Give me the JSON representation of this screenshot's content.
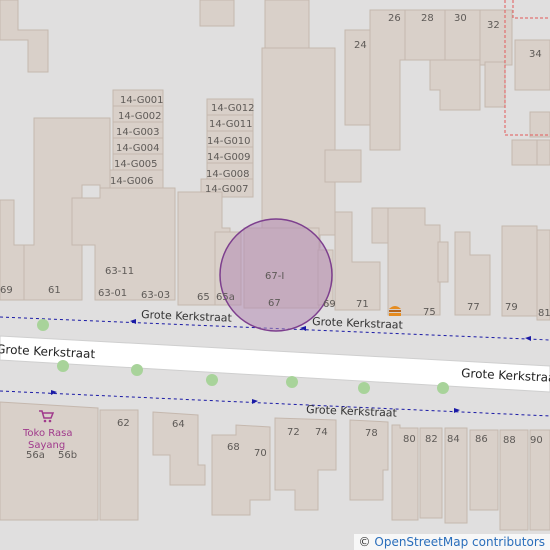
{
  "map": {
    "background_color": "#e0dfdf",
    "building_color": "#d9d0c9",
    "road_color": "#ffffff",
    "footway_color": "#1a1aa6",
    "highlight_color": "#b48cb4",
    "boundary_color": "#e25a5a",
    "tree_color": "#a8d39a"
  },
  "streets": {
    "upper": "Grote Kerkstraat",
    "upper_right": "Grote Kerkstraat",
    "main_left": "Grote Kerkstraat",
    "main_right": "Grote Kerkstraat",
    "lower": "Grote Kerkstraat"
  },
  "poi": {
    "icon": "shop-icon",
    "name_line1": "Toko Rasa",
    "name_line2": "Sayang",
    "food_icon": "fast-food-icon"
  },
  "house_numbers": {
    "n26": "26",
    "n28": "28",
    "n30": "30",
    "n32": "32",
    "n34": "34",
    "n24": "24",
    "g001": "14-G001",
    "g002": "14-G002",
    "g003": "14-G003",
    "g004": "14-G004",
    "g005": "14-G005",
    "g006": "14-G006",
    "g012": "14-G012",
    "g011": "14-G011",
    "g010": "14-G010",
    "g009": "14-G009",
    "g008": "14-G008",
    "g007": "14-G007",
    "n69a": "69",
    "n61": "61",
    "n63_11": "63-11",
    "n63_01": "63-01",
    "n63_03": "63-03",
    "n65": "65",
    "n65a": "65a",
    "n67i": "67-I",
    "n67": "67",
    "n69": "69",
    "n71": "71",
    "n75": "75",
    "n77": "77",
    "n79": "79",
    "n81": "81",
    "n62": "62",
    "n64": "64",
    "n56a": "56a",
    "n56b": "56b",
    "n68": "68",
    "n70": "70",
    "n72": "72",
    "n74": "74",
    "n78": "78",
    "n80": "80",
    "n82": "82",
    "n84": "84",
    "n86": "86",
    "n88": "88",
    "n90": "90"
  },
  "attribution": {
    "symbol": "©",
    "text": "OpenStreetMap contributors"
  }
}
